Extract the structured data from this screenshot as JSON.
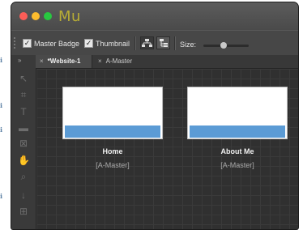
{
  "app": {
    "logo": "Mu"
  },
  "window_controls": {
    "close_color": "#fc5d57",
    "minimize_color": "#fdbc2e",
    "zoom_color": "#28c840"
  },
  "toolbar": {
    "master_badge_label": "Master Badge",
    "master_badge_checked": true,
    "thumbnail_label": "Thumbnail",
    "thumbnail_checked": true,
    "check_mark": "✓",
    "sitemap_view_icon": "sitemap-tree-icon",
    "list_view_icon": "list-tree-icon",
    "size_label": "Size:",
    "size_slider_value": 0.45
  },
  "tabs": [
    {
      "close": "×",
      "label": "*Website-1",
      "active": true
    },
    {
      "close": "×",
      "label": "A-Master",
      "active": false
    }
  ],
  "tools_panel": {
    "collapse": "»",
    "icons": [
      "selection-arrow-icon",
      "crop-icon",
      "text-icon",
      "rectangle-icon",
      "image-frame-icon",
      "hand-icon",
      "zoom-icon",
      "download-icon",
      "grid-icon"
    ]
  },
  "pages": [
    {
      "name": "Home",
      "master": "[A-Master]"
    },
    {
      "name": "About Me",
      "master": "[A-Master]"
    }
  ],
  "colors": {
    "app_logo": "#b8ad35",
    "thumbnail_bar": "#5b9bd5"
  }
}
